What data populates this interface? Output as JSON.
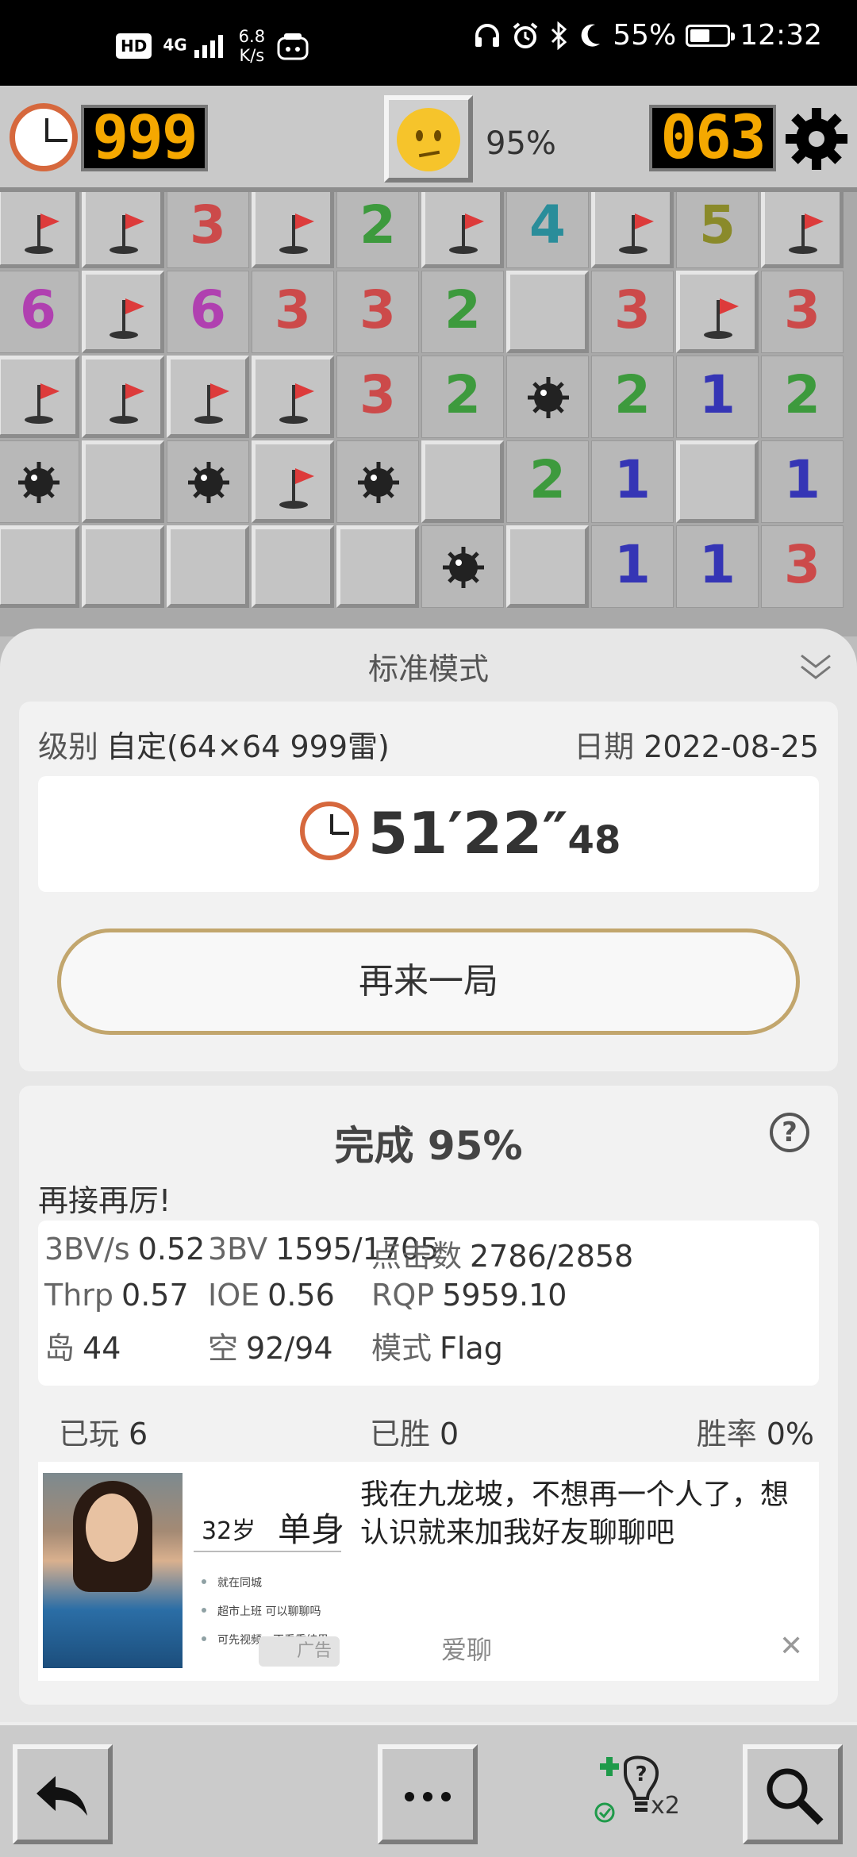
{
  "status_bar": {
    "hd": "HD",
    "network": "4G",
    "speed_value": "6.8",
    "speed_unit": "K/s",
    "battery": "55%",
    "battery_level": 0.55,
    "time": "12:32"
  },
  "top_bar": {
    "timer": "999",
    "completion": "95%",
    "mines_left": "063",
    "face": "neutral-face"
  },
  "board": {
    "cells": [
      [
        "F",
        "F",
        "3",
        "F",
        "2",
        "F",
        "4",
        "F",
        "5",
        "F"
      ],
      [
        "6",
        "F",
        "6",
        "3",
        "3",
        "2",
        "",
        "3",
        "F",
        "3"
      ],
      [
        "F",
        "F",
        "F",
        "F",
        "3",
        "2",
        "M",
        "2",
        "1",
        "2"
      ],
      [
        "M",
        "",
        "M",
        "F",
        "M",
        "",
        "2",
        "1",
        "",
        "1"
      ],
      [
        "",
        "",
        "",
        "",
        "",
        "M",
        "",
        "1",
        "1",
        "3"
      ]
    ],
    "number_colors": {
      "1": "#3535b5",
      "2": "#3d9a3d",
      "3": "#cc4a4a",
      "4": "#2a8d9a",
      "5": "#8a8a2a",
      "6": "#b040b0"
    }
  },
  "result_panel": {
    "mode_title": "标准模式",
    "level_label": "级别",
    "level_value": "自定(64×64  999雷)",
    "date_label": "日期",
    "date_value": "2022-08-25",
    "time_main": "51′22″",
    "time_fraction": "48",
    "play_again": "再来一局",
    "completion_title": "完成 95%",
    "encouragement": "再接再厉!",
    "stats": {
      "bv_s_label": "3BV/s",
      "bv_s": "0.52",
      "bv_label": "3BV",
      "bv": "1595/1705",
      "clicks_label": "点击数",
      "clicks": "2786/2858",
      "thrp_label": "Thrp",
      "thrp": "0.57",
      "ioe_label": "IOE",
      "ioe": "0.56",
      "rqp_label": "RQP",
      "rqp": "5959.10",
      "island_label": "岛",
      "island": "44",
      "empty_label": "空",
      "empty": "92/94",
      "mode_label": "模式",
      "mode": "Flag"
    },
    "record": {
      "played_label": "已玩",
      "played": "6",
      "won_label": "已胜",
      "won": "0",
      "rate_label": "胜率",
      "rate": "0%"
    }
  },
  "ad": {
    "age": "32岁",
    "status": "单身",
    "bullets": [
      "就在同城",
      "超市上班 可以聊聊吗",
      "可先视频，不看重结果"
    ],
    "text": "我在九龙坡，不想再一个人了，想认识就来加我好友聊聊吧",
    "badge": "广告",
    "brand": "爱聊",
    "close": "✕"
  },
  "bottom_bar": {
    "hint_multiplier": "x2"
  },
  "colors": {
    "counter_digits": "#f5a800",
    "clock_ring": "#d6683d",
    "play_again_border": "#c2a66d"
  }
}
